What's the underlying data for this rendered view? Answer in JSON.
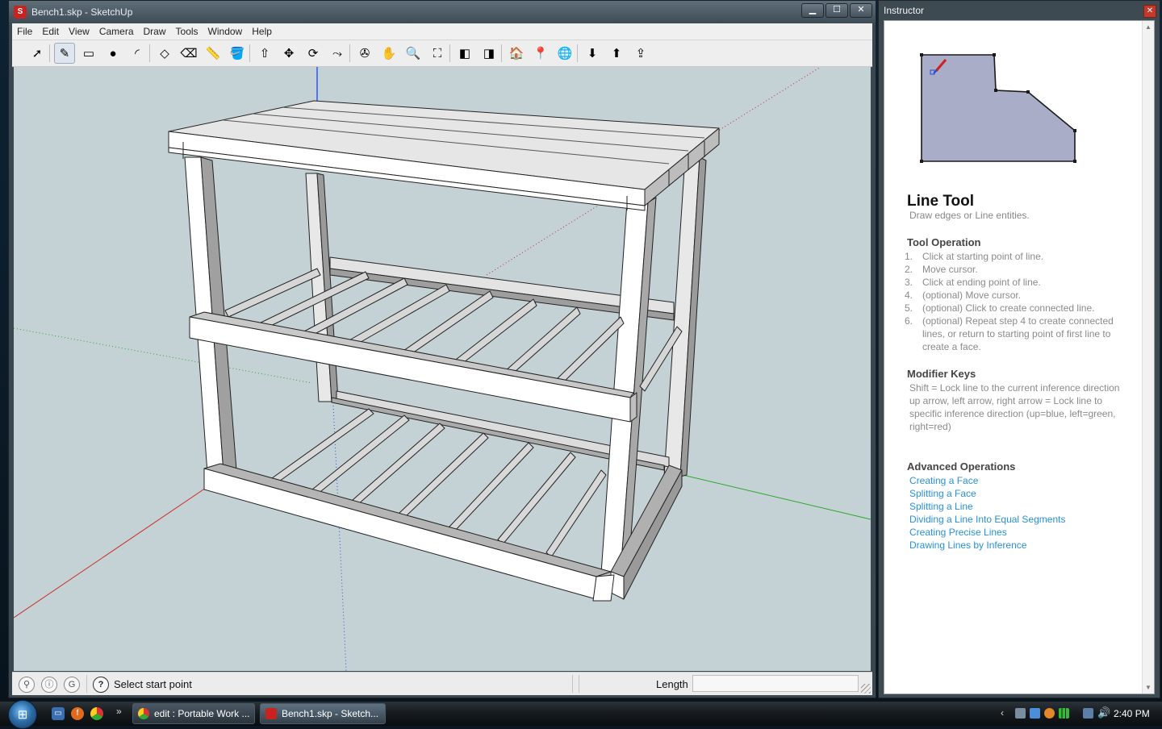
{
  "sketchup": {
    "window_title": "Bench1.skp - SketchUp",
    "title_icon": "sketchup-logo-icon",
    "window_buttons": [
      "minimize",
      "maximize",
      "close"
    ],
    "menu": [
      "File",
      "Edit",
      "View",
      "Camera",
      "Draw",
      "Tools",
      "Window",
      "Help"
    ],
    "toolbar": [
      {
        "name": "select-tool-icon",
        "glyph": "➚"
      },
      {
        "name": "line-tool-icon",
        "glyph": "✎",
        "active": true
      },
      {
        "name": "rectangle-tool-icon",
        "glyph": "▭"
      },
      {
        "name": "circle-tool-icon",
        "glyph": "●"
      },
      {
        "name": "arc-tool-icon",
        "glyph": "◜"
      },
      {
        "name": "make-component-icon",
        "glyph": "◇"
      },
      {
        "name": "eraser-tool-icon",
        "glyph": "⌫"
      },
      {
        "name": "tape-measure-icon",
        "glyph": "📏"
      },
      {
        "name": "paint-bucket-icon",
        "glyph": "🪣"
      },
      {
        "name": "push-pull-icon",
        "glyph": "⇧"
      },
      {
        "name": "move-tool-icon",
        "glyph": "✥"
      },
      {
        "name": "rotate-tool-icon",
        "glyph": "⟳"
      },
      {
        "name": "offset-tool-icon",
        "glyph": "⤳"
      },
      {
        "name": "orbit-tool-icon",
        "glyph": "✇"
      },
      {
        "name": "pan-tool-icon",
        "glyph": "✋"
      },
      {
        "name": "zoom-tool-icon",
        "glyph": "🔍"
      },
      {
        "name": "zoom-extents-icon",
        "glyph": "⛶"
      },
      {
        "name": "previous-view-icon",
        "glyph": "◧"
      },
      {
        "name": "next-view-icon",
        "glyph": "◨"
      },
      {
        "name": "3d-warehouse-icon",
        "glyph": "🏠"
      },
      {
        "name": "add-location-icon",
        "glyph": "📍"
      },
      {
        "name": "google-earth-icon",
        "glyph": "🌐"
      },
      {
        "name": "get-models-icon",
        "glyph": "⬇"
      },
      {
        "name": "share-model-icon",
        "glyph": "⬆"
      },
      {
        "name": "share-component-icon",
        "glyph": "⇪"
      }
    ],
    "status": {
      "icons": [
        "geo-location-icon",
        "credits-icon",
        "google-signin-icon",
        "help-icon"
      ],
      "message": "Select start point",
      "length_label": "Length",
      "length_value": ""
    }
  },
  "instructor": {
    "title": "Instructor",
    "tool_name": "Line Tool",
    "tool_desc": "Draw edges or Line entities.",
    "operation_heading": "Tool Operation",
    "operations": [
      {
        "num": "1.",
        "text": "Click at starting point of line."
      },
      {
        "num": "2.",
        "text": "Move cursor."
      },
      {
        "num": "3.",
        "text": "Click at ending point of line."
      },
      {
        "num": "4.",
        "text": "(optional) Move cursor."
      },
      {
        "num": "5.",
        "text": "(optional) Click to create connected line."
      },
      {
        "num": "6.",
        "text": "(optional) Repeat step 4 to create connected lines, or return to starting point of first line to create a face."
      }
    ],
    "modifier_heading": "Modifier Keys",
    "modifiers": [
      "Shift = Lock line to the current inference direction",
      "up arrow, left arrow, right arrow = Lock line to specific inference direction (up=blue, left=green, right=red)"
    ],
    "advanced_heading": "Advanced Operations",
    "advanced_links": [
      "Creating a Face",
      "Splitting a Face",
      "Splitting a Line",
      "Dividing a Line Into Equal Segments",
      "Creating Precise Lines",
      "Drawing Lines by Inference"
    ]
  },
  "taskbar": {
    "tasks": [
      {
        "label": "edit : Portable Work ...",
        "icon": "chrome-icon",
        "active": false
      },
      {
        "label": "Bench1.skp - Sketch...",
        "icon": "sketchup-icon",
        "active": true
      }
    ],
    "quick_launch": [
      "show-desktop-icon",
      "firefox-icon",
      "chrome-icon"
    ],
    "quick_more": "»",
    "clock": "2:40 PM"
  },
  "colors": {
    "viewport_bg": "#c4d2d6",
    "axis_red": "#cc2a2a",
    "axis_green": "#2aa82a",
    "axis_blue": "#2b4fd6",
    "link": "#2a90d6",
    "face_blue": "#a9adc8"
  }
}
